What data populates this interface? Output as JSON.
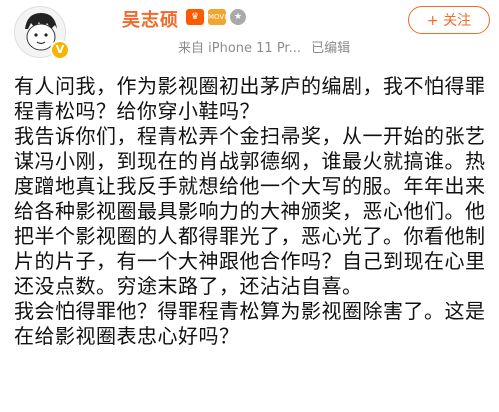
{
  "header": {
    "author_name": "吴志硕",
    "verified_badge": "V",
    "badges": [
      {
        "name": "crown",
        "label": "♛"
      },
      {
        "name": "movie",
        "label": "MOVIE"
      },
      {
        "name": "star",
        "label": "★"
      }
    ],
    "source": "来自 iPhone 11 Pr...",
    "edited": "已编辑",
    "follow_label": "+ 关注"
  },
  "post": {
    "paragraphs": [
      "有人问我，作为影视圈初出茅庐的编剧，我不怕得罪程青松吗？给你穿小鞋吗？",
      "我告诉你们，程青松弄个金扫帚奖，从一开始的张艺谋冯小刚，到现在的肖战郭德纲，谁最火就搞谁。热度蹭地真让我反手就想给他一个大写的服。年年出来给各种影视圈最具影响力的大神颁奖，恶心他们。他把半个影视圈的人都得罪光了，恶心光了。你看他制片的片子，有一个大神跟他合作吗？自己到现在心里还没点数。穷途末路了，还沾沾自喜。",
      "我会怕得罪他？得罪程青松算为影视圈除害了。这是在给影视圈表忠心好吗？"
    ]
  },
  "colors": {
    "name": "#f26a2a",
    "meta": "#8c8c8c",
    "text": "#111111"
  }
}
